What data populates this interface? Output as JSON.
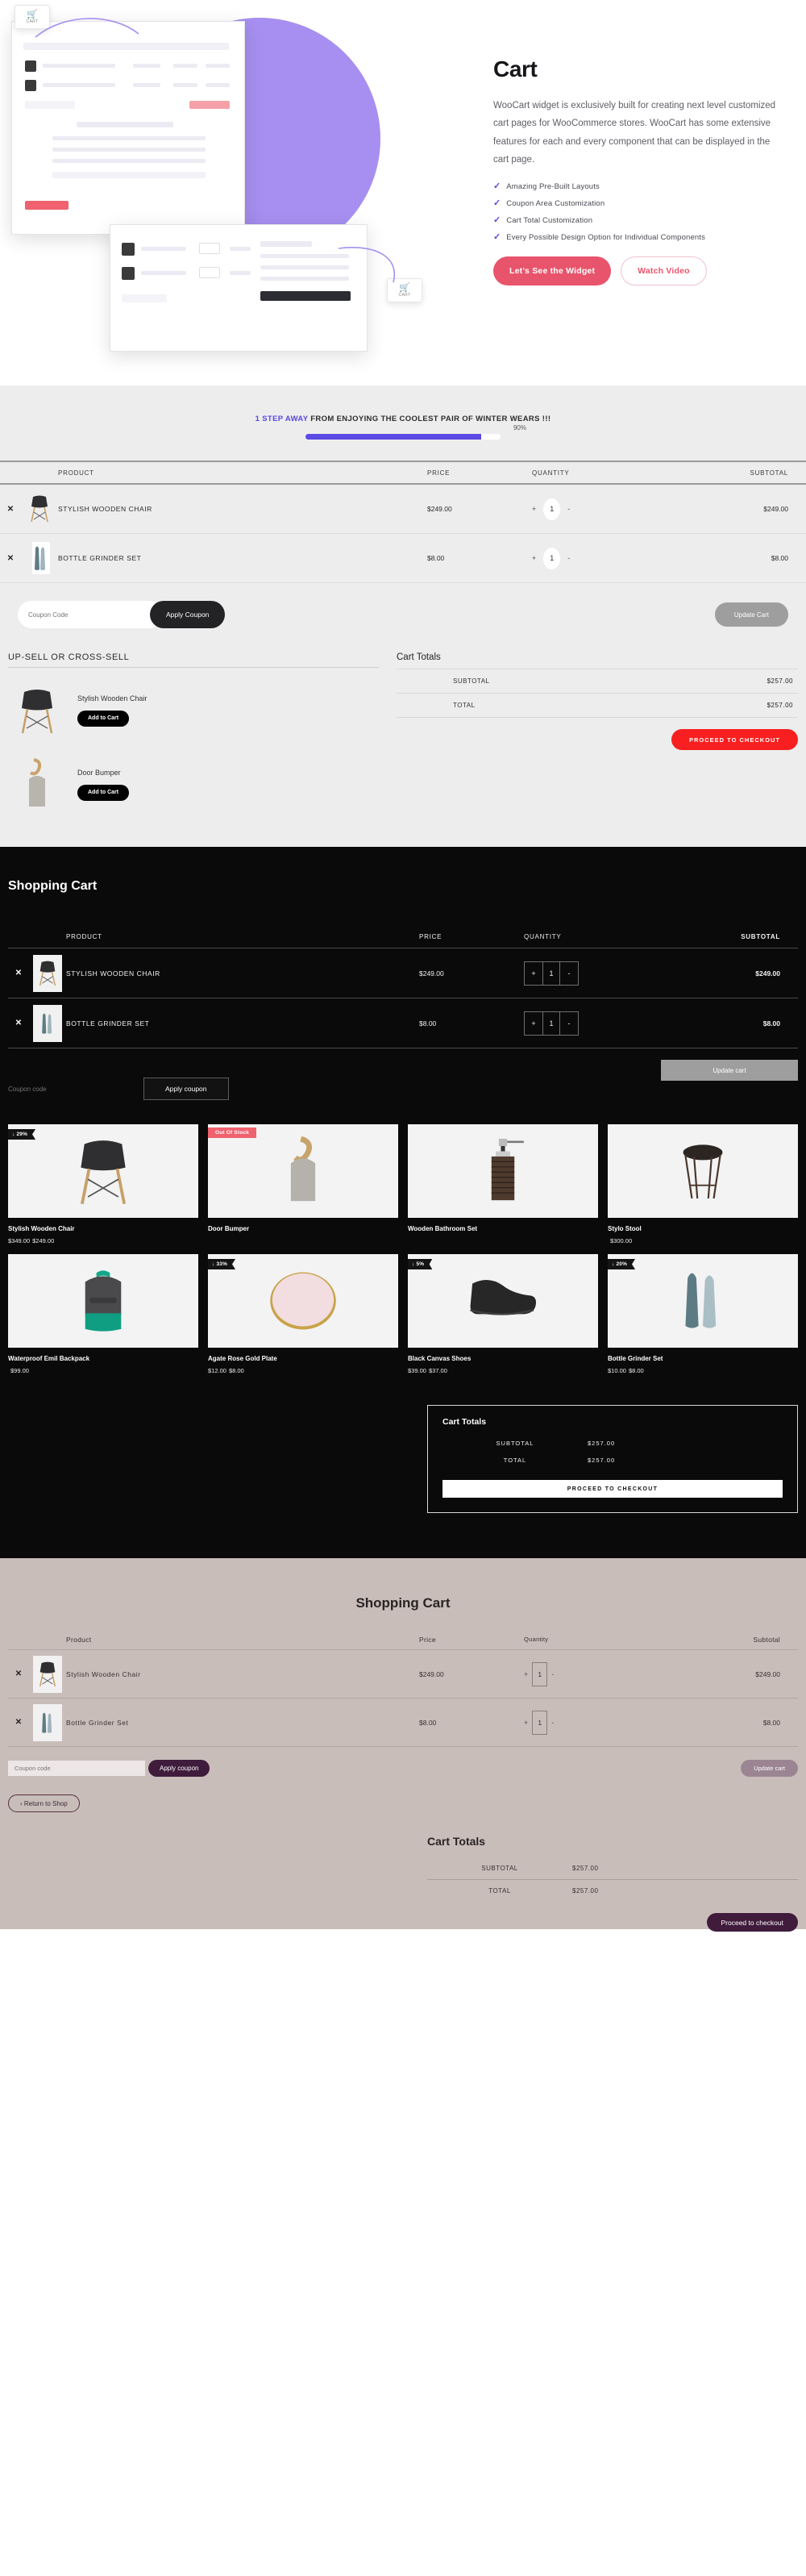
{
  "hero": {
    "title": "Cart",
    "description": "WooCart widget is exclusively built for creating next level customized cart pages for WooCommerce stores. WooCart has some extensive features for each and every component that can be displayed in the cart page.",
    "features": [
      "Amazing Pre-Built Layouts",
      "Coupon Area Customization",
      "Cart Total Customization",
      "Every Possible Design Option for Individual Components"
    ],
    "primary_button": "Let's See the Widget",
    "secondary_button": "Watch Video",
    "mock_badge_label": "CART",
    "accent_purple": "#a68ff0",
    "accent_pink": "#e8546b"
  },
  "light_section": {
    "progress": {
      "accent_text": "1 STEP AWAY",
      "message": " FROM ENJOYING THE COOLEST PAIR OF WINTER WEARS !!!",
      "percent_label": "90%",
      "percent_value": 90,
      "fill_color": "#5b4ae4"
    },
    "table": {
      "headers": [
        "PRODUCT",
        "PRICE",
        "QUANTITY",
        "SUBTOTAL"
      ],
      "remove_label": "✕",
      "rows": [
        {
          "name": "STYLISH WOODEN CHAIR",
          "price": "$249.00",
          "qty": "1",
          "subtotal": "$249.00",
          "icon": "chair"
        },
        {
          "name": "BOTTLE GRINDER SET",
          "price": "$8.00",
          "qty": "1",
          "subtotal": "$8.00",
          "icon": "bottles"
        }
      ],
      "qty_plus": "+",
      "qty_minus": "-"
    },
    "coupon_placeholder": "Coupon Code",
    "apply_coupon_label": "Apply Coupon",
    "update_cart_label": "Update Cart",
    "upsell": {
      "title": "UP-SELL OR CROSS-SELL",
      "items": [
        {
          "name": "Stylish Wooden Chair",
          "button": "Add to Cart",
          "icon": "chair"
        },
        {
          "name": "Door Bumper",
          "button": "Add to Cart",
          "icon": "bumper"
        }
      ]
    },
    "totals": {
      "title": "Cart Totals",
      "rows": [
        {
          "label": "SUBTOTAL",
          "value": "$257.00"
        },
        {
          "label": "TOTAL",
          "value": "$257.00"
        }
      ],
      "checkout_label": "PROCEED TO CHECKOUT"
    }
  },
  "dark_section": {
    "title": "Shopping Cart",
    "table": {
      "headers": [
        "PRODUCT",
        "PRICE",
        "QUANTITY",
        "SUBTOTAL"
      ],
      "remove_label": "✕",
      "rows": [
        {
          "name": "STYLISH WOODEN CHAIR",
          "price": "$249.00",
          "qty": "1",
          "subtotal": "$249.00",
          "icon": "chair"
        },
        {
          "name": "BOTTLE GRINDER SET",
          "price": "$8.00",
          "qty": "1",
          "subtotal": "$8.00",
          "icon": "bottles"
        }
      ],
      "qty_plus": "+",
      "qty_minus": "-"
    },
    "update_cart_label": "Update cart",
    "coupon_placeholder": "Coupon code",
    "apply_coupon_label": "Apply coupon",
    "products": [
      {
        "name": "Stylish Wooden Chair",
        "badge": "↓ 29%",
        "badge_type": "sale",
        "price_old": "$349.00",
        "price_new": "$249.00",
        "icon": "chair"
      },
      {
        "name": "Door Bumper",
        "badge": "Out Of Stock",
        "badge_type": "oos",
        "price_old": "",
        "price_new": "",
        "icon": "bumper"
      },
      {
        "name": "Wooden Bathroom Set",
        "badge": "",
        "badge_type": "",
        "price_old": "",
        "price_new": "",
        "icon": "dispenser"
      },
      {
        "name": "Stylo Stool",
        "badge": "",
        "badge_type": "",
        "price_old": "",
        "price_new": "$300.00",
        "icon": "stool"
      },
      {
        "name": "Waterproof Emil Backpack",
        "badge": "",
        "badge_type": "",
        "price_old": "",
        "price_new": "$99.00",
        "icon": "backpack"
      },
      {
        "name": "Agate Rose Gold Plate",
        "badge": "↓ 33%",
        "badge_type": "sale",
        "price_old": "$12.00",
        "price_new": "$8.00",
        "icon": "plate"
      },
      {
        "name": "Black Canvas Shoes",
        "badge": "↓ 5%",
        "badge_type": "sale",
        "price_old": "$39.00",
        "price_new": "$37.00",
        "icon": "shoes"
      },
      {
        "name": "Bottle Grinder Set",
        "badge": "↓ 20%",
        "badge_type": "sale",
        "price_old": "$10.00",
        "price_new": "$8.00",
        "icon": "bottles"
      }
    ],
    "totals": {
      "title": "Cart Totals",
      "rows": [
        {
          "label": "SUBTOTAL",
          "value": "$257.00"
        },
        {
          "label": "TOTAL",
          "value": "$257.00"
        }
      ],
      "checkout_label": "PROCEED TO CHECKOUT"
    }
  },
  "beige_section": {
    "title": "Shopping Cart",
    "table": {
      "headers": [
        "Product",
        "Price",
        "Quantity",
        "Subtotal"
      ],
      "remove_label": "✕",
      "rows": [
        {
          "name": "Stylish Wooden Chair",
          "price": "$249.00",
          "qty": "1",
          "subtotal": "$249.00",
          "icon": "chair"
        },
        {
          "name": "Bottle Grinder Set",
          "price": "$8.00",
          "qty": "1",
          "subtotal": "$8.00",
          "icon": "bottles"
        }
      ],
      "qty_plus": "+",
      "qty_minus": "-"
    },
    "coupon_placeholder": "Coupon code",
    "apply_coupon_label": "Apply coupon",
    "update_cart_label": "Update cart",
    "return_label": "‹  Return to Shop",
    "totals": {
      "title": "Cart Totals",
      "rows": [
        {
          "label": "SUBTOTAL",
          "value": "$257.00"
        },
        {
          "label": "TOTAL",
          "value": "$257.00"
        }
      ],
      "checkout_label": "Proceed to checkout"
    }
  }
}
